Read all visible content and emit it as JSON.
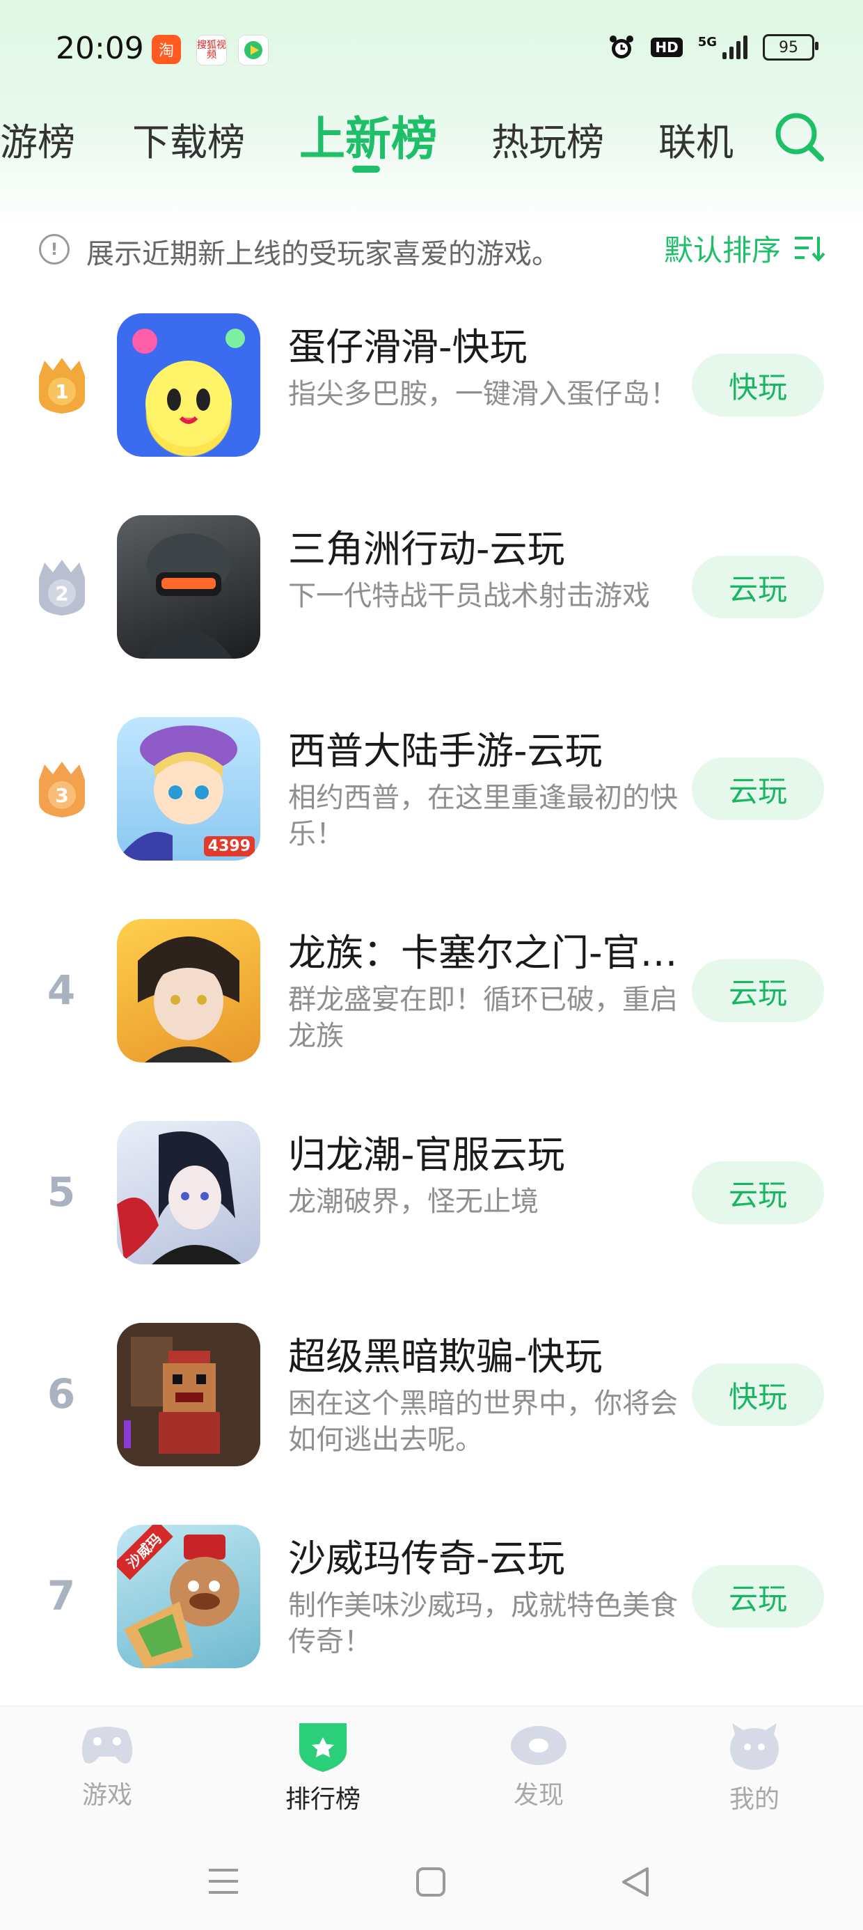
{
  "status_bar": {
    "time": "20:09",
    "app_icons": [
      "taobao-icon",
      "sohu-video-icon",
      "video-app-icon"
    ],
    "app_labels": [
      "淘",
      "搜狐视频",
      ""
    ],
    "network": "5G",
    "battery": "95"
  },
  "tabs": [
    {
      "label": "游榜",
      "active": false
    },
    {
      "label": "下载榜",
      "active": false
    },
    {
      "label": "上新榜",
      "active": true
    },
    {
      "label": "热玩榜",
      "active": false
    },
    {
      "label": "联机",
      "active": false
    }
  ],
  "notice": {
    "text": "展示近期新上线的受玩家喜爱的游戏。",
    "sort_label": "默认排序"
  },
  "games": [
    {
      "rank": "1",
      "title": "蛋仔滑滑-快玩",
      "desc": "指尖多巴胺，一键滑入蛋仔岛！",
      "button": "快玩"
    },
    {
      "rank": "2",
      "title": "三角洲行动-云玩",
      "desc": "下一代特战干员战术射击游戏",
      "button": "云玩"
    },
    {
      "rank": "3",
      "title": "西普大陆手游-云玩",
      "desc": "相约西普，在这里重逢最初的快乐！",
      "button": "云玩"
    },
    {
      "rank": "4",
      "title": "龙族：卡塞尔之门-官…",
      "desc": "群龙盛宴在即！循环已破，重启龙族",
      "button": "云玩"
    },
    {
      "rank": "5",
      "title": "归龙潮-官服云玩",
      "desc": "龙潮破界，怪无止境",
      "button": "云玩"
    },
    {
      "rank": "6",
      "title": "超级黑暗欺骗-快玩",
      "desc": "困在这个黑暗的世界中，你将会如何逃出去呢。",
      "button": "快玩"
    },
    {
      "rank": "7",
      "title": "沙威玛传奇-云玩",
      "desc": "制作美味沙威玛，成就特色美食传奇！",
      "button": "云玩"
    }
  ],
  "app_icon_texts": {
    "game3": "4399",
    "game7": "沙威玛"
  },
  "bottom_nav": [
    {
      "label": "游戏",
      "icon": "gamepad-icon",
      "active": false
    },
    {
      "label": "排行榜",
      "icon": "ranking-shield-icon",
      "active": true
    },
    {
      "label": "发现",
      "icon": "discover-eye-icon",
      "active": false
    },
    {
      "label": "我的",
      "icon": "profile-mascot-icon",
      "active": false
    }
  ],
  "colors": {
    "accent": "#1fbf6a",
    "button_bg": "#e6f8ec",
    "gold": "#f3a83b",
    "silver": "#b9bfd0",
    "bronze": "#f4a14e"
  }
}
